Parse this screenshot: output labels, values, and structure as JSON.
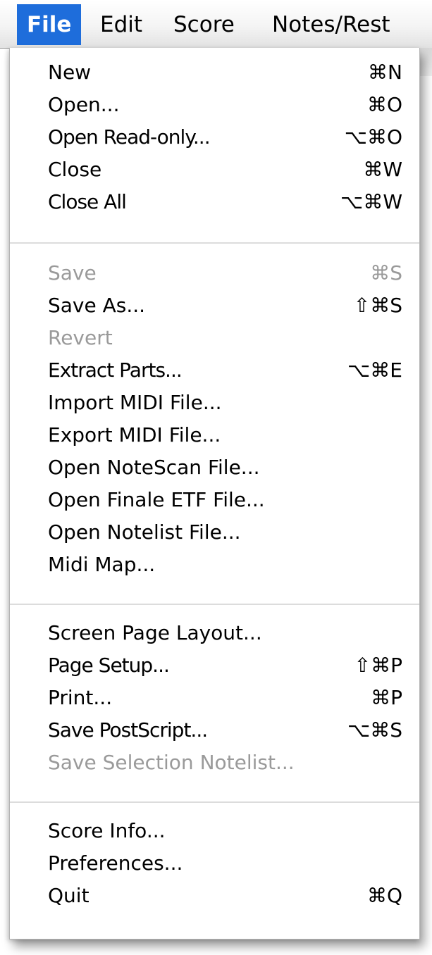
{
  "menubar": {
    "items": [
      {
        "label": "File",
        "selected": true
      },
      {
        "label": "Edit"
      },
      {
        "label": "Score"
      },
      {
        "label": "Notes/Rest"
      }
    ]
  },
  "menu": {
    "groups": [
      [
        {
          "label": "New",
          "shortcut": "⌘N",
          "enabled": true
        },
        {
          "label": "Open...",
          "shortcut": "⌘O",
          "enabled": true
        },
        {
          "label": "Open Read-only...",
          "shortcut": "⌥⌘O",
          "enabled": true
        },
        {
          "label": "Close",
          "shortcut": "⌘W",
          "enabled": true
        },
        {
          "label": "Close All",
          "shortcut": "⌥⌘W",
          "enabled": true
        }
      ],
      [
        {
          "label": "Save",
          "shortcut": "⌘S",
          "enabled": false
        },
        {
          "label": "Save As...",
          "shortcut": "⇧⌘S",
          "enabled": true
        },
        {
          "label": "Revert",
          "shortcut": "",
          "enabled": false
        },
        {
          "label": "Extract Parts...",
          "shortcut": "⌥⌘E",
          "enabled": true
        },
        {
          "label": "Import MIDI File...",
          "shortcut": "",
          "enabled": true
        },
        {
          "label": "Export MIDI File...",
          "shortcut": "",
          "enabled": true
        },
        {
          "label": "Open NoteScan File...",
          "shortcut": "",
          "enabled": true
        },
        {
          "label": "Open Finale ETF File...",
          "shortcut": "",
          "enabled": true
        },
        {
          "label": "Open Notelist File...",
          "shortcut": "",
          "enabled": true
        },
        {
          "label": "Midi Map...",
          "shortcut": "",
          "enabled": true
        }
      ],
      [
        {
          "label": "Screen Page Layout...",
          "shortcut": "",
          "enabled": true
        },
        {
          "label": "Page Setup...",
          "shortcut": "⇧⌘P",
          "enabled": true
        },
        {
          "label": "Print...",
          "shortcut": "⌘P",
          "enabled": true
        },
        {
          "label": "Save PostScript...",
          "shortcut": "⌥⌘S",
          "enabled": true
        },
        {
          "label": "Save Selection Notelist...",
          "shortcut": "",
          "enabled": false
        }
      ],
      [
        {
          "label": "Score Info...",
          "shortcut": "",
          "enabled": true
        },
        {
          "label": "Preferences...",
          "shortcut": "",
          "enabled": true
        },
        {
          "label": "Quit",
          "shortcut": "⌘Q",
          "enabled": true
        }
      ]
    ]
  },
  "colors": {
    "selection": "#1e6ddb",
    "disabled_text": "#9a9a9a",
    "separator": "#dcdcdc"
  }
}
